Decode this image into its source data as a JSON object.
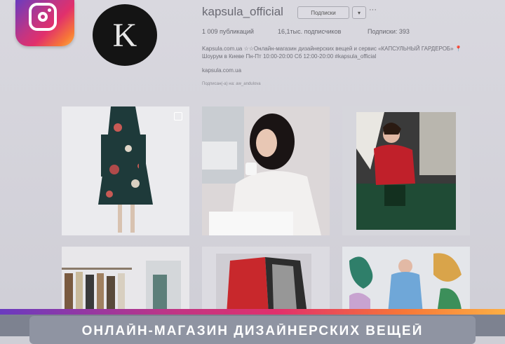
{
  "profile": {
    "avatar_letter": "K",
    "username": "kapsula_official",
    "follow_label": "Подписки",
    "arrow_label": "▾",
    "more_label": "···",
    "stats": {
      "posts": "1 009 публикаций",
      "followers": "16,1тыс. подписчиков",
      "following": "Подписки: 393"
    },
    "bio": "Kapsula.com.ua ☆☆Онлайн-магазин дизайнерских вещей и сервис «КАПСУЛЬНЫЙ ГАРДЕРОБ» 📍Шоурум в Киеве Пн-Пт 10:00-20:00 Сб 12:00-20:00 #kapsula_official",
    "link": "kapsula.com.ua",
    "tagged": "Подписан(-а) на: aw_andulova"
  },
  "caption": {
    "text": "ОНЛАЙН-МАГАЗИН ДИЗАЙНЕРСКИХ ВЕЩЕЙ"
  },
  "colors": {
    "instagram_gradient": [
      "#6a3bbf",
      "#c13584",
      "#e1306c",
      "#f77737",
      "#fcaf45"
    ],
    "page_bg": "#d9d8df",
    "caption_bg": "#8f94a2"
  },
  "icons": [
    "instagram-logo-icon",
    "multiple-images-icon",
    "chevron-down-icon",
    "more-icon"
  ]
}
